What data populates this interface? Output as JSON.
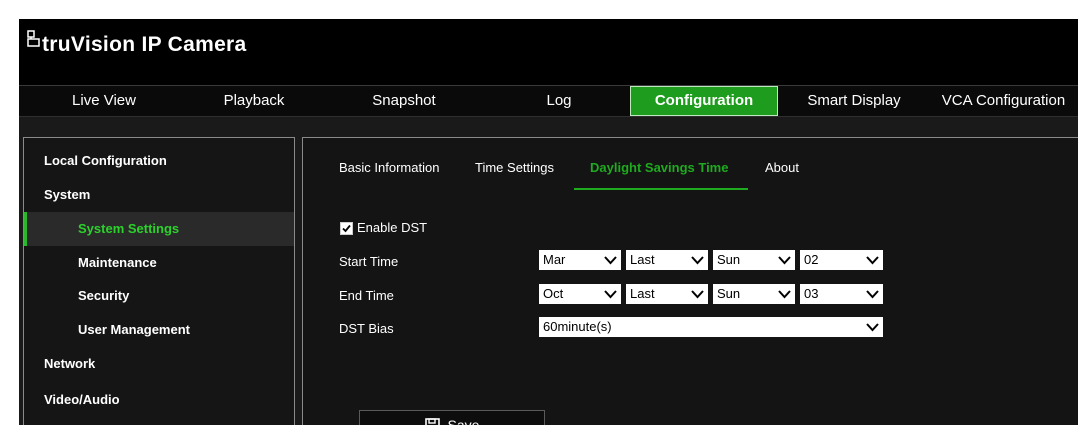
{
  "app": {
    "title": "truVision IP Camera",
    "brand_color": "#1e9c1e"
  },
  "topnav": {
    "tabs": [
      {
        "label": "Live View"
      },
      {
        "label": "Playback"
      },
      {
        "label": "Snapshot"
      },
      {
        "label": "Log"
      },
      {
        "label": "Configuration",
        "active": true
      },
      {
        "label": "Smart Display"
      },
      {
        "label": "VCA Configuration"
      }
    ]
  },
  "sidebar": {
    "items": [
      {
        "label": "Local Configuration",
        "level": 1
      },
      {
        "label": "System",
        "level": 1
      },
      {
        "label": "System Settings",
        "level": 2,
        "active": true
      },
      {
        "label": "Maintenance",
        "level": 2
      },
      {
        "label": "Security",
        "level": 2
      },
      {
        "label": "User Management",
        "level": 2
      },
      {
        "label": "Network",
        "level": 1
      },
      {
        "label": "Video/Audio",
        "level": 1
      }
    ]
  },
  "subtabs": [
    {
      "label": "Basic Information"
    },
    {
      "label": "Time Settings"
    },
    {
      "label": "Daylight Savings Time",
      "active": true
    },
    {
      "label": "About"
    }
  ],
  "form": {
    "enable_dst": {
      "label": "Enable DST",
      "checked": true
    },
    "start_time": {
      "label": "Start Time",
      "month": "Mar",
      "week": "Last",
      "day": "Sun",
      "hour": "02"
    },
    "end_time": {
      "label": "End Time",
      "month": "Oct",
      "week": "Last",
      "day": "Sun",
      "hour": "03"
    },
    "dst_bias": {
      "label": "DST Bias",
      "value": "60minute(s)"
    },
    "save_label": "Save"
  }
}
